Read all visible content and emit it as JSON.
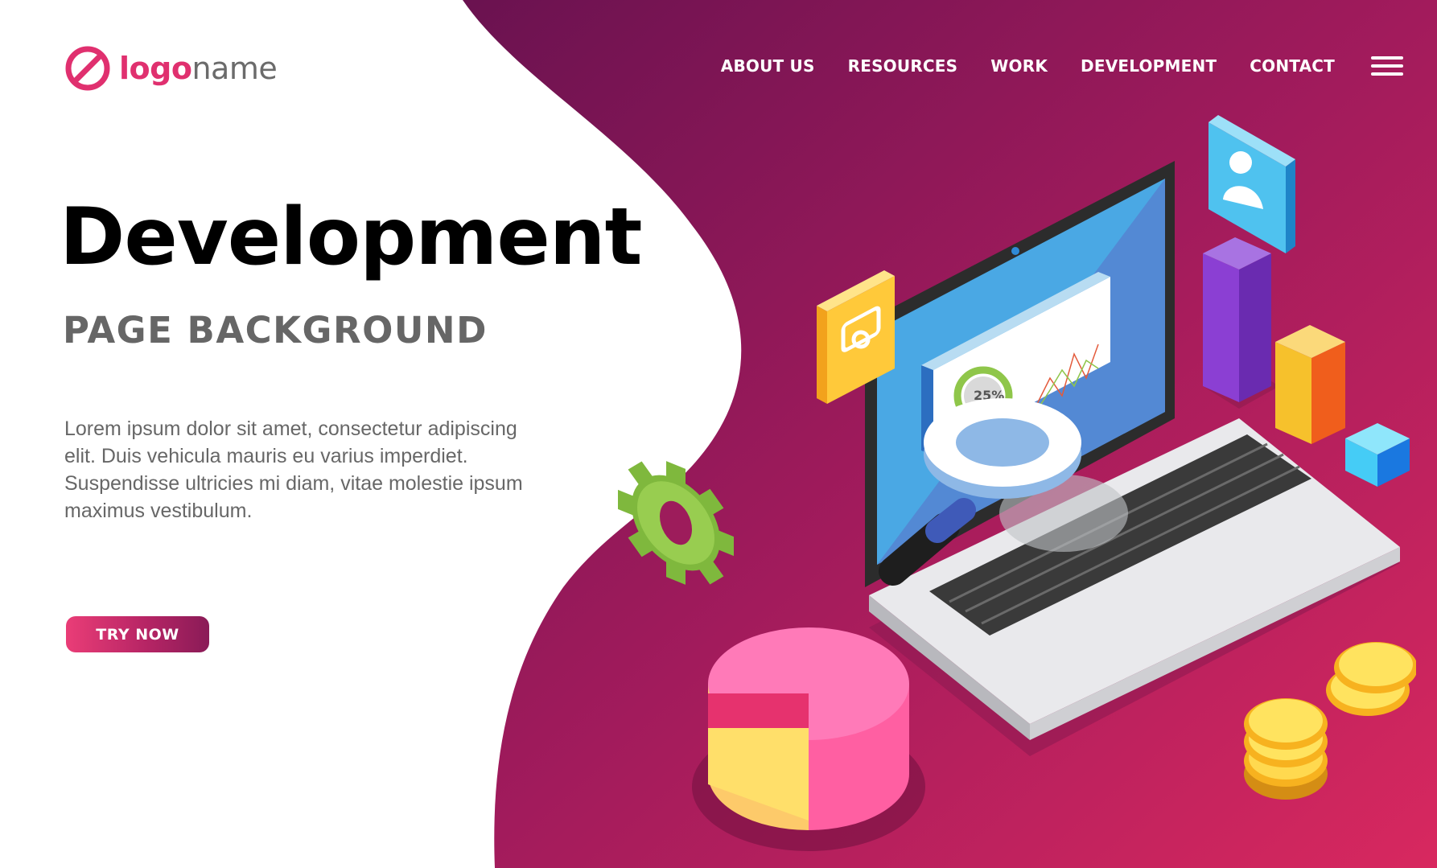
{
  "logo": {
    "text_strong": "logo",
    "text_light": "name",
    "icon": "slashed-circle-icon"
  },
  "nav": {
    "items": [
      "ABOUT US",
      "RESOURCES",
      "WORK",
      "DEVELOPMENT",
      "CONTACT"
    ],
    "menu_icon": "hamburger-menu-icon"
  },
  "hero": {
    "title": "Development",
    "subtitle": "PAGE BACKGROUND",
    "body": "Lorem ipsum dolor sit amet, consectetur adipiscing elit. Duis vehicula mauris eu varius imperdiet. Suspendisse ultricies mi diam, vitae molestie ipsum maximus vestibulum.",
    "cta_label": "TRY NOW"
  },
  "illustration": {
    "progress_label": "25%",
    "icons": [
      "gear-icon",
      "camera-icon",
      "user-profile-icon",
      "laptop-icon",
      "magnifier-icon",
      "pie-chart-icon",
      "coins-icon",
      "bar-chart-icon"
    ]
  },
  "colors": {
    "accent": "#e0306f",
    "gradient_dark": "#6e1450",
    "gradient_light": "#d8285f",
    "text_dark": "#000000",
    "text_muted": "#666666"
  }
}
